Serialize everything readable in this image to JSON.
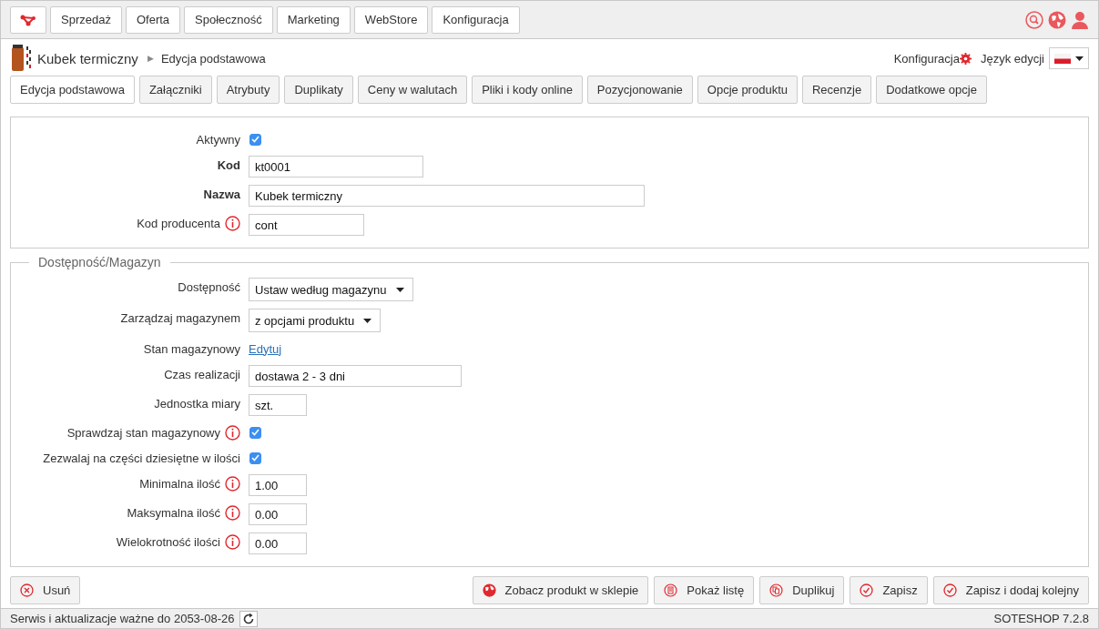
{
  "top_menu": [
    {
      "label": "Sprzedaż"
    },
    {
      "label": "Oferta"
    },
    {
      "label": "Społeczność"
    },
    {
      "label": "Marketing"
    },
    {
      "label": "WebStore"
    },
    {
      "label": "Konfiguracja"
    }
  ],
  "breadcrumb": {
    "product": "Kubek termiczny",
    "separator": "▶",
    "page": "Edycja podstawowa"
  },
  "header_links": {
    "config": "Konfiguracja",
    "language_label": "Język edycji"
  },
  "tabs": [
    {
      "label": "Edycja podstawowa",
      "selected": true
    },
    {
      "label": "Załączniki",
      "selected": false
    },
    {
      "label": "Atrybuty",
      "selected": false
    },
    {
      "label": "Duplikaty",
      "selected": false
    },
    {
      "label": "Ceny w walutach",
      "selected": false
    },
    {
      "label": "Pliki i kody online",
      "selected": false
    },
    {
      "label": "Pozycjonowanie",
      "selected": false
    },
    {
      "label": "Opcje produktu",
      "selected": false
    },
    {
      "label": "Recenzje",
      "selected": false
    },
    {
      "label": "Dodatkowe opcje",
      "selected": false
    }
  ],
  "sections": [
    {
      "fields": [
        {
          "kind": "checkbox",
          "label": "Aktywny",
          "checked": true,
          "info": false,
          "bold": false
        },
        {
          "kind": "input",
          "label": "Kod",
          "value": "kt0001",
          "info": false,
          "bold": true
        },
        {
          "kind": "input",
          "label": "Nazwa",
          "value": "Kubek termiczny",
          "info": false,
          "bold": true
        },
        {
          "kind": "input",
          "label": "Kod producenta",
          "value": "cont",
          "info": true,
          "bold": false
        }
      ]
    },
    {
      "legend": "Dostępność/Magazyn",
      "fields": [
        {
          "kind": "select",
          "label": "Dostępność",
          "value": "Ustaw według magazynu",
          "info": false,
          "bold": false
        },
        {
          "kind": "select",
          "label": "Zarządzaj magazynem",
          "value": "z opcjami produktu",
          "info": false,
          "bold": false
        },
        {
          "kind": "link",
          "label": "Stan magazynowy",
          "value": "Edytuj",
          "info": false,
          "bold": false
        },
        {
          "kind": "input",
          "label": "Czas realizacji",
          "value": "dostawa 2 - 3 dni",
          "info": false,
          "bold": false
        },
        {
          "kind": "input",
          "label": "Jednostka miary",
          "value": "szt.",
          "info": false,
          "bold": false
        },
        {
          "kind": "checkbox",
          "label": "Sprawdzaj stan magazynowy",
          "checked": true,
          "info": true,
          "bold": false
        },
        {
          "kind": "checkbox",
          "label": "Zezwalaj na części dziesiętne w ilości",
          "checked": true,
          "info": false,
          "bold": false
        },
        {
          "kind": "input",
          "label": "Minimalna ilość",
          "value": "1.00",
          "info": true,
          "bold": false
        },
        {
          "kind": "input",
          "label": "Maksymalna ilość",
          "value": "0.00",
          "info": true,
          "bold": false
        },
        {
          "kind": "input",
          "label": "Wielokrotność ilości",
          "value": "0.00",
          "info": true,
          "bold": false
        }
      ]
    }
  ],
  "actions": {
    "left": [
      {
        "kind": "delete",
        "label": "Usuń"
      }
    ],
    "right": [
      {
        "kind": "view",
        "label": "Zobacz produkt w sklepie"
      },
      {
        "kind": "list",
        "label": "Pokaż listę"
      },
      {
        "kind": "duplicate",
        "label": "Duplikuj"
      },
      {
        "kind": "save",
        "label": "Zapisz"
      },
      {
        "kind": "save",
        "label": "Zapisz i dodaj kolejny"
      }
    ]
  },
  "status_bar": {
    "service": "Serwis i aktualizacje ważne do 2053-08-26",
    "version": "SOTESHOP 7.2.8"
  }
}
